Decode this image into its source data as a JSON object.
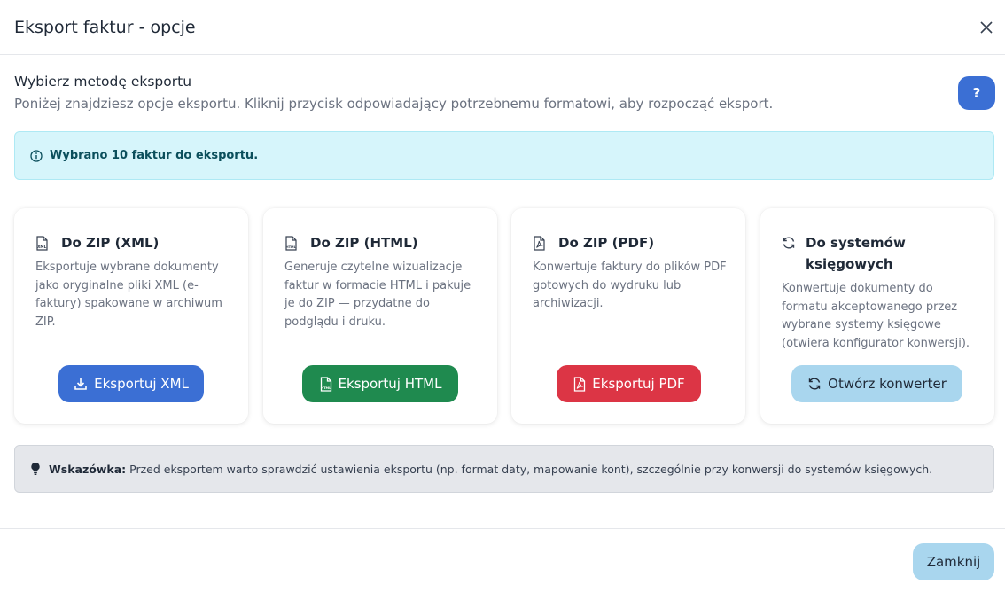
{
  "modal": {
    "title": "Eksport faktur - opcje"
  },
  "section": {
    "heading": "Wybierz metodę eksportu",
    "subtitle": "Poniżej znajdziesz opcje eksportu. Kliknij przycisk odpowiadający potrzebnemu formatowi, aby rozpocząć eksport.",
    "help_label": "?"
  },
  "info": {
    "text": "Wybrano 10 faktur do eksportu."
  },
  "cards": [
    {
      "title": "Do ZIP (XML)",
      "icon": "file-xml-icon",
      "description": "Eksportuje wybrane dokumenty jako oryginalne pliki XML (e-faktury) spakowane w archiwum ZIP.",
      "button": "Eksportuj XML",
      "button_icon": "download-icon",
      "color": "#3b6fd4"
    },
    {
      "title": "Do ZIP (HTML)",
      "icon": "file-html-icon",
      "description": "Generuje czytelne wizualizacje faktur w formacie HTML i pakuje je do ZIP — przydatne do podglądu i druku.",
      "button": "Eksportuj HTML",
      "button_icon": "file-html-icon",
      "color": "#1f8a4f"
    },
    {
      "title": "Do ZIP (PDF)",
      "icon": "file-pdf-icon",
      "description": "Konwertuje faktury do plików PDF gotowych do wydruku lub archiwizacji.",
      "button": "Eksportuj PDF",
      "button_icon": "file-pdf-icon",
      "color": "#dc3545"
    },
    {
      "title": "Do systemów księgowych",
      "icon": "refresh-icon",
      "description": "Konwertuje dokumenty do formatu akceptowanego przez wybrane systemy księgowe (otwiera konfigurator konwersji).",
      "button": "Otwórz konwerter",
      "button_icon": "refresh-icon",
      "color": "#a9d6ee"
    }
  ],
  "tip": {
    "label": "Wskazówka:",
    "text": "Przed eksportem warto sprawdzić ustawienia eksportu (np. format daty, mapowanie kont), szczególnie przy konwersji do systemów księgowych."
  },
  "footer": {
    "close_label": "Zamknij"
  }
}
